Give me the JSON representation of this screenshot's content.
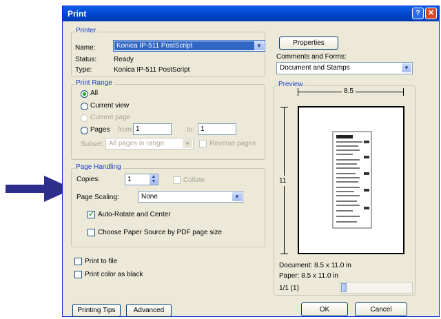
{
  "window": {
    "title": "Print"
  },
  "printer": {
    "group_label": "Printer",
    "name_label": "Name:",
    "name_value": "Konica IP-511 PostScript",
    "status_label": "Status:",
    "status_value": "Ready",
    "type_label": "Type:",
    "type_value": "Konica IP-511 PostScript",
    "properties_button": "Properties",
    "comments_label": "Comments and Forms:",
    "comments_value": "Document and Stamps"
  },
  "print_range": {
    "group_label": "Print Range",
    "all": "All",
    "current_view": "Current view",
    "current_page": "Current page",
    "pages": "Pages",
    "from_label": "from:",
    "from_value": "1",
    "to_label": "to:",
    "to_value": "1",
    "subset_label": "Subset:",
    "subset_value": "All pages in range",
    "reverse_pages": "Reverse pages"
  },
  "page_handling": {
    "group_label": "Page Handling",
    "copies_label": "Copies:",
    "copies_value": "1",
    "collate": "Collate",
    "scaling_label": "Page Scaling:",
    "scaling_value": "None",
    "auto_rotate": "Auto-Rotate and Center",
    "choose_paper": "Choose Paper Source by PDF page size"
  },
  "options": {
    "print_to_file": "Print to file",
    "print_color_black": "Print color as black"
  },
  "preview": {
    "group_label": "Preview",
    "width_label": "8.5",
    "height_label": "11",
    "document_size": "Document: 8.5 x 11.0 in",
    "paper_size": "Paper: 8.5 x 11.0 in",
    "page_counter": "1/1 (1)"
  },
  "buttons": {
    "printing_tips": "Printing Tips",
    "advanced": "Advanced",
    "ok": "OK",
    "cancel": "Cancel"
  },
  "colors": {
    "arrow": "#2e2e8c",
    "titlebar": "#0a5ee8",
    "accent_text": "#1a3fc8"
  }
}
